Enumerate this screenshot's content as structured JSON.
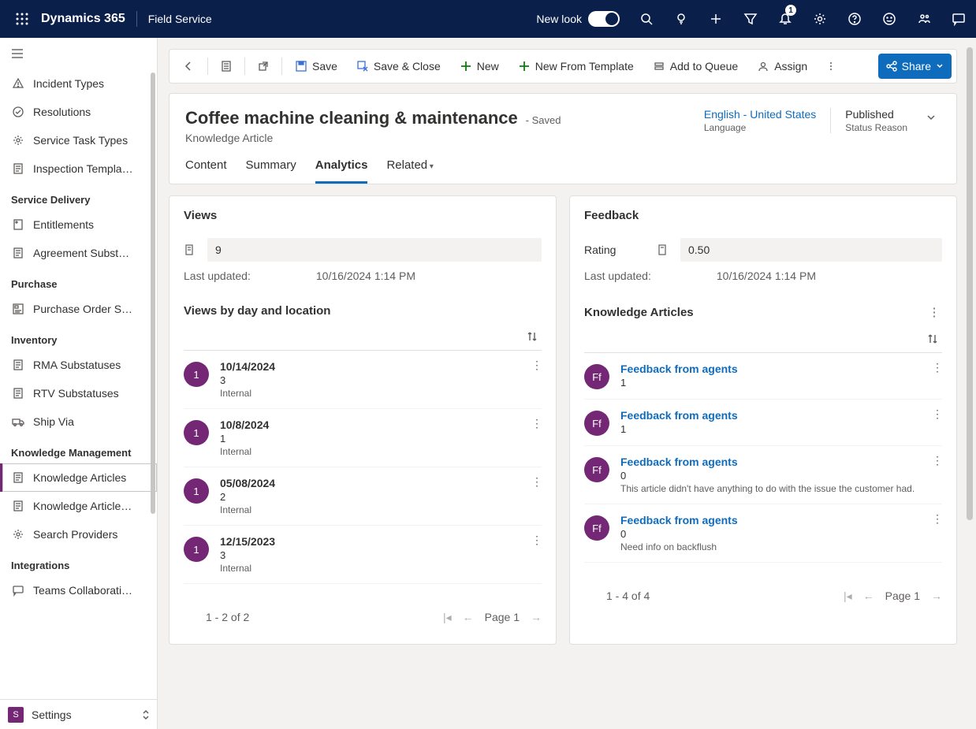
{
  "topbar": {
    "brand": "Dynamics 365",
    "app": "Field Service",
    "newlook": "New look",
    "notification_count": "1"
  },
  "sidebar": {
    "groups": [
      {
        "items": [
          {
            "icon": "warn",
            "label": "Incident Types"
          },
          {
            "icon": "check",
            "label": "Resolutions"
          },
          {
            "icon": "gear",
            "label": "Service Task Types"
          },
          {
            "icon": "doc",
            "label": "Inspection Templa…"
          }
        ]
      },
      {
        "title": "Service Delivery",
        "items": [
          {
            "icon": "tag",
            "label": "Entitlements"
          },
          {
            "icon": "doc",
            "label": "Agreement Subst…"
          }
        ]
      },
      {
        "title": "Purchase",
        "items": [
          {
            "icon": "form",
            "label": "Purchase Order S…"
          }
        ]
      },
      {
        "title": "Inventory",
        "items": [
          {
            "icon": "doc",
            "label": "RMA Substatuses"
          },
          {
            "icon": "doc",
            "label": "RTV Substatuses"
          },
          {
            "icon": "truck",
            "label": "Ship Via"
          }
        ]
      },
      {
        "title": "Knowledge Management",
        "items": [
          {
            "icon": "doc",
            "label": "Knowledge Articles",
            "selected": true
          },
          {
            "icon": "doc",
            "label": "Knowledge Article…"
          },
          {
            "icon": "gear",
            "label": "Search Providers"
          }
        ]
      },
      {
        "title": "Integrations",
        "items": [
          {
            "icon": "chat",
            "label": "Teams Collaborati…"
          }
        ]
      }
    ],
    "area": {
      "badge": "S",
      "label": "Settings"
    }
  },
  "commands": {
    "back": "Back",
    "save": "Save",
    "saveclose": "Save & Close",
    "new": "New",
    "newtpl": "New From Template",
    "queue": "Add to Queue",
    "assign": "Assign",
    "share": "Share"
  },
  "header": {
    "title": "Coffee machine cleaning & maintenance",
    "saved": "- Saved",
    "subtitle": "Knowledge Article",
    "lang_value": "English - United States",
    "lang_label": "Language",
    "status_value": "Published",
    "status_label": "Status Reason",
    "tabs": {
      "content": "Content",
      "summary": "Summary",
      "analytics": "Analytics",
      "related": "Related"
    }
  },
  "views": {
    "title": "Views",
    "count": "9",
    "updated_label": "Last updated:",
    "updated": "10/16/2024 1:14 PM",
    "sub": "Views by day and location",
    "items": [
      {
        "num": "1",
        "date": "10/14/2024",
        "cnt": "3",
        "src": "Internal"
      },
      {
        "num": "1",
        "date": "10/8/2024",
        "cnt": "1",
        "src": "Internal"
      },
      {
        "num": "1",
        "date": "05/08/2024",
        "cnt": "2",
        "src": "Internal"
      },
      {
        "num": "1",
        "date": "12/15/2023",
        "cnt": "3",
        "src": "Internal"
      }
    ],
    "pager_info": "1 - 2 of 2",
    "pager_page": "Page 1"
  },
  "feedback": {
    "title": "Feedback",
    "rating_label": "Rating",
    "rating": "0.50",
    "updated_label": "Last updated:",
    "updated": "10/16/2024 1:14 PM",
    "sub": "Knowledge Articles",
    "items": [
      {
        "init": "Ff",
        "title": "Feedback from agents",
        "score": "1",
        "note": ""
      },
      {
        "init": "Ff",
        "title": "Feedback from agents",
        "score": "1",
        "note": ""
      },
      {
        "init": "Ff",
        "title": "Feedback from agents",
        "score": "0",
        "note": "This article didn't have anything to do with the issue the customer had."
      },
      {
        "init": "Ff",
        "title": "Feedback from agents",
        "score": "0",
        "note": "Need info on backflush"
      }
    ],
    "pager_info": "1 - 4 of 4",
    "pager_page": "Page 1"
  }
}
